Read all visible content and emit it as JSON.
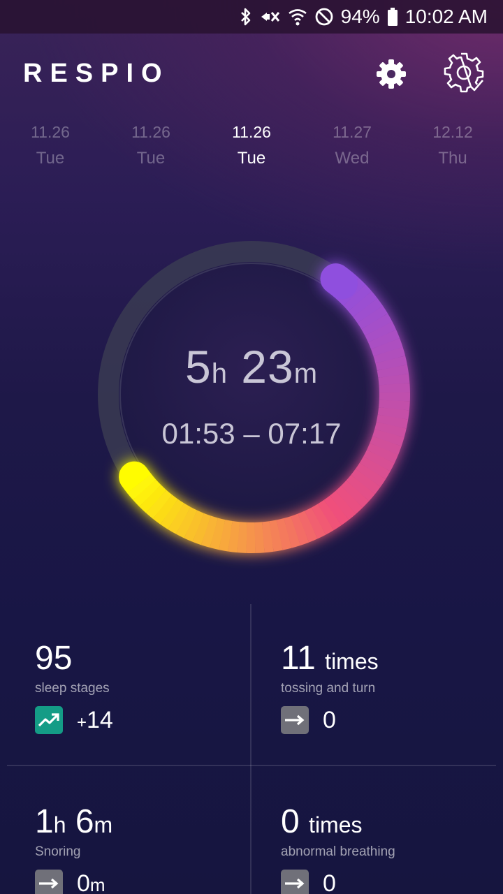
{
  "status_bar": {
    "battery_percent": "94%",
    "time": "10:02 AM",
    "icons": [
      "bluetooth-icon",
      "vibrate-icon",
      "wifi-icon",
      "do-not-disturb-icon",
      "battery-icon"
    ]
  },
  "header": {
    "app_title": "RESPIO",
    "settings_icon": "gear-icon",
    "device_settings_icon": "gear-outline-icon"
  },
  "dates": [
    {
      "date": "11.26",
      "day": "Tue",
      "active": false
    },
    {
      "date": "11.26",
      "day": "Tue",
      "active": false
    },
    {
      "date": "11.26",
      "day": "Tue",
      "active": true
    },
    {
      "date": "11.27",
      "day": "Wed",
      "active": false
    },
    {
      "date": "12.12",
      "day": "Thu",
      "active": false
    }
  ],
  "sleep": {
    "hours": "5",
    "hours_unit": "h",
    "minutes": "23",
    "minutes_unit": "m",
    "time_range": "01:53 – 07:17",
    "colors": {
      "track": "#3a3b52",
      "arc_start": "#ffff00",
      "arc_mid": "#f0507a",
      "arc_end": "#8e4fe0"
    }
  },
  "stats": {
    "sleep_stages": {
      "value": "95",
      "label": "sleep stages",
      "trend": "up",
      "change_sign": "+",
      "change": "14",
      "color": "#149c86"
    },
    "tossing": {
      "value": "11",
      "unit": "times",
      "label": "tossing and turn",
      "trend": "flat",
      "change": "0"
    },
    "snoring": {
      "hours": "1",
      "hours_unit": "h",
      "minutes": "6",
      "minutes_unit": "m",
      "label": "Snoring",
      "trend": "flat",
      "change": "0",
      "change_unit": "m"
    },
    "abnormal": {
      "value": "0",
      "unit": "times",
      "label": "abnormal breathing",
      "trend": "flat",
      "change": "0"
    }
  }
}
